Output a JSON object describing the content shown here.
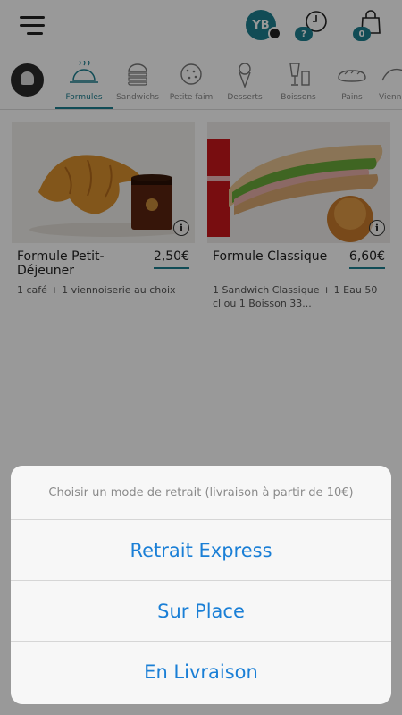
{
  "header": {
    "avatar_initials": "YB",
    "history_badge": "?",
    "cart_badge": "0",
    "accent": "#1d7f8f"
  },
  "categories": [
    {
      "label": "Formules",
      "icon": "cloche-icon",
      "active": true
    },
    {
      "label": "Sandwichs",
      "icon": "burger-icon",
      "active": false
    },
    {
      "label": "Petite faim",
      "icon": "cookie-icon",
      "active": false
    },
    {
      "label": "Desserts",
      "icon": "ice-cream-icon",
      "active": false
    },
    {
      "label": "Boissons",
      "icon": "drinks-icon",
      "active": false
    },
    {
      "label": "Pains",
      "icon": "bread-icon",
      "active": false
    },
    {
      "label": "Vienn",
      "icon": "croissant-icon",
      "active": false
    }
  ],
  "products": [
    {
      "name": "Formule Petit-Déjeuner",
      "price": "2,50€",
      "description": "1 café + 1 viennoiserie au choix"
    },
    {
      "name": "Formule Classique",
      "price": "6,60€",
      "description": "1 Sandwich Classique + 1 Eau 50 cl ou 1 Boisson 33..."
    }
  ],
  "sheet": {
    "title": "Choisir un mode de retrait (livraison à partir de 10€)",
    "options": [
      "Retrait Express",
      "Sur Place",
      "En Livraison"
    ],
    "option_color": "#1a7fd6"
  }
}
